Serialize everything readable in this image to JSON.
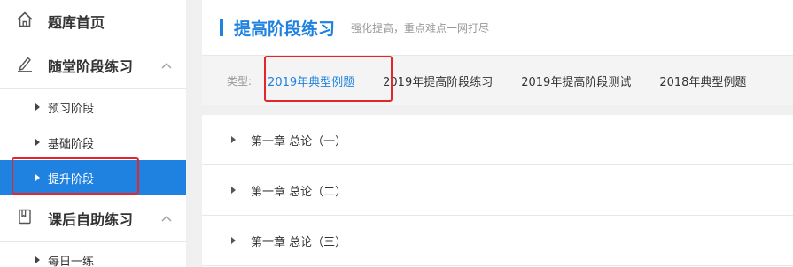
{
  "sidebar": {
    "home": {
      "label": "题库首页",
      "icon": "home-icon"
    },
    "groups": [
      {
        "label": "随堂阶段练习",
        "icon": "pen-icon",
        "items": [
          {
            "label": "预习阶段"
          },
          {
            "label": "基础阶段"
          },
          {
            "label": "提升阶段",
            "active": true
          }
        ]
      },
      {
        "label": "课后自助练习",
        "icon": "book-icon",
        "items": [
          {
            "label": "每日一练"
          }
        ]
      }
    ]
  },
  "header": {
    "title": "提高阶段练习",
    "subtitle": "强化提高，重点难点一网打尽"
  },
  "typebar": {
    "label": "类型:",
    "tabs": [
      {
        "label": "2019年典型例题",
        "active": true
      },
      {
        "label": "2019年提高阶段练习"
      },
      {
        "label": "2019年提高阶段测试"
      },
      {
        "label": "2018年典型例题"
      }
    ]
  },
  "chapters": [
    {
      "label": "第一章 总论（一）"
    },
    {
      "label": "第一章 总论（二）"
    },
    {
      "label": "第一章 总论（三）"
    }
  ],
  "colors": {
    "accent": "#1f82e0",
    "highlight": "#e3262b"
  }
}
